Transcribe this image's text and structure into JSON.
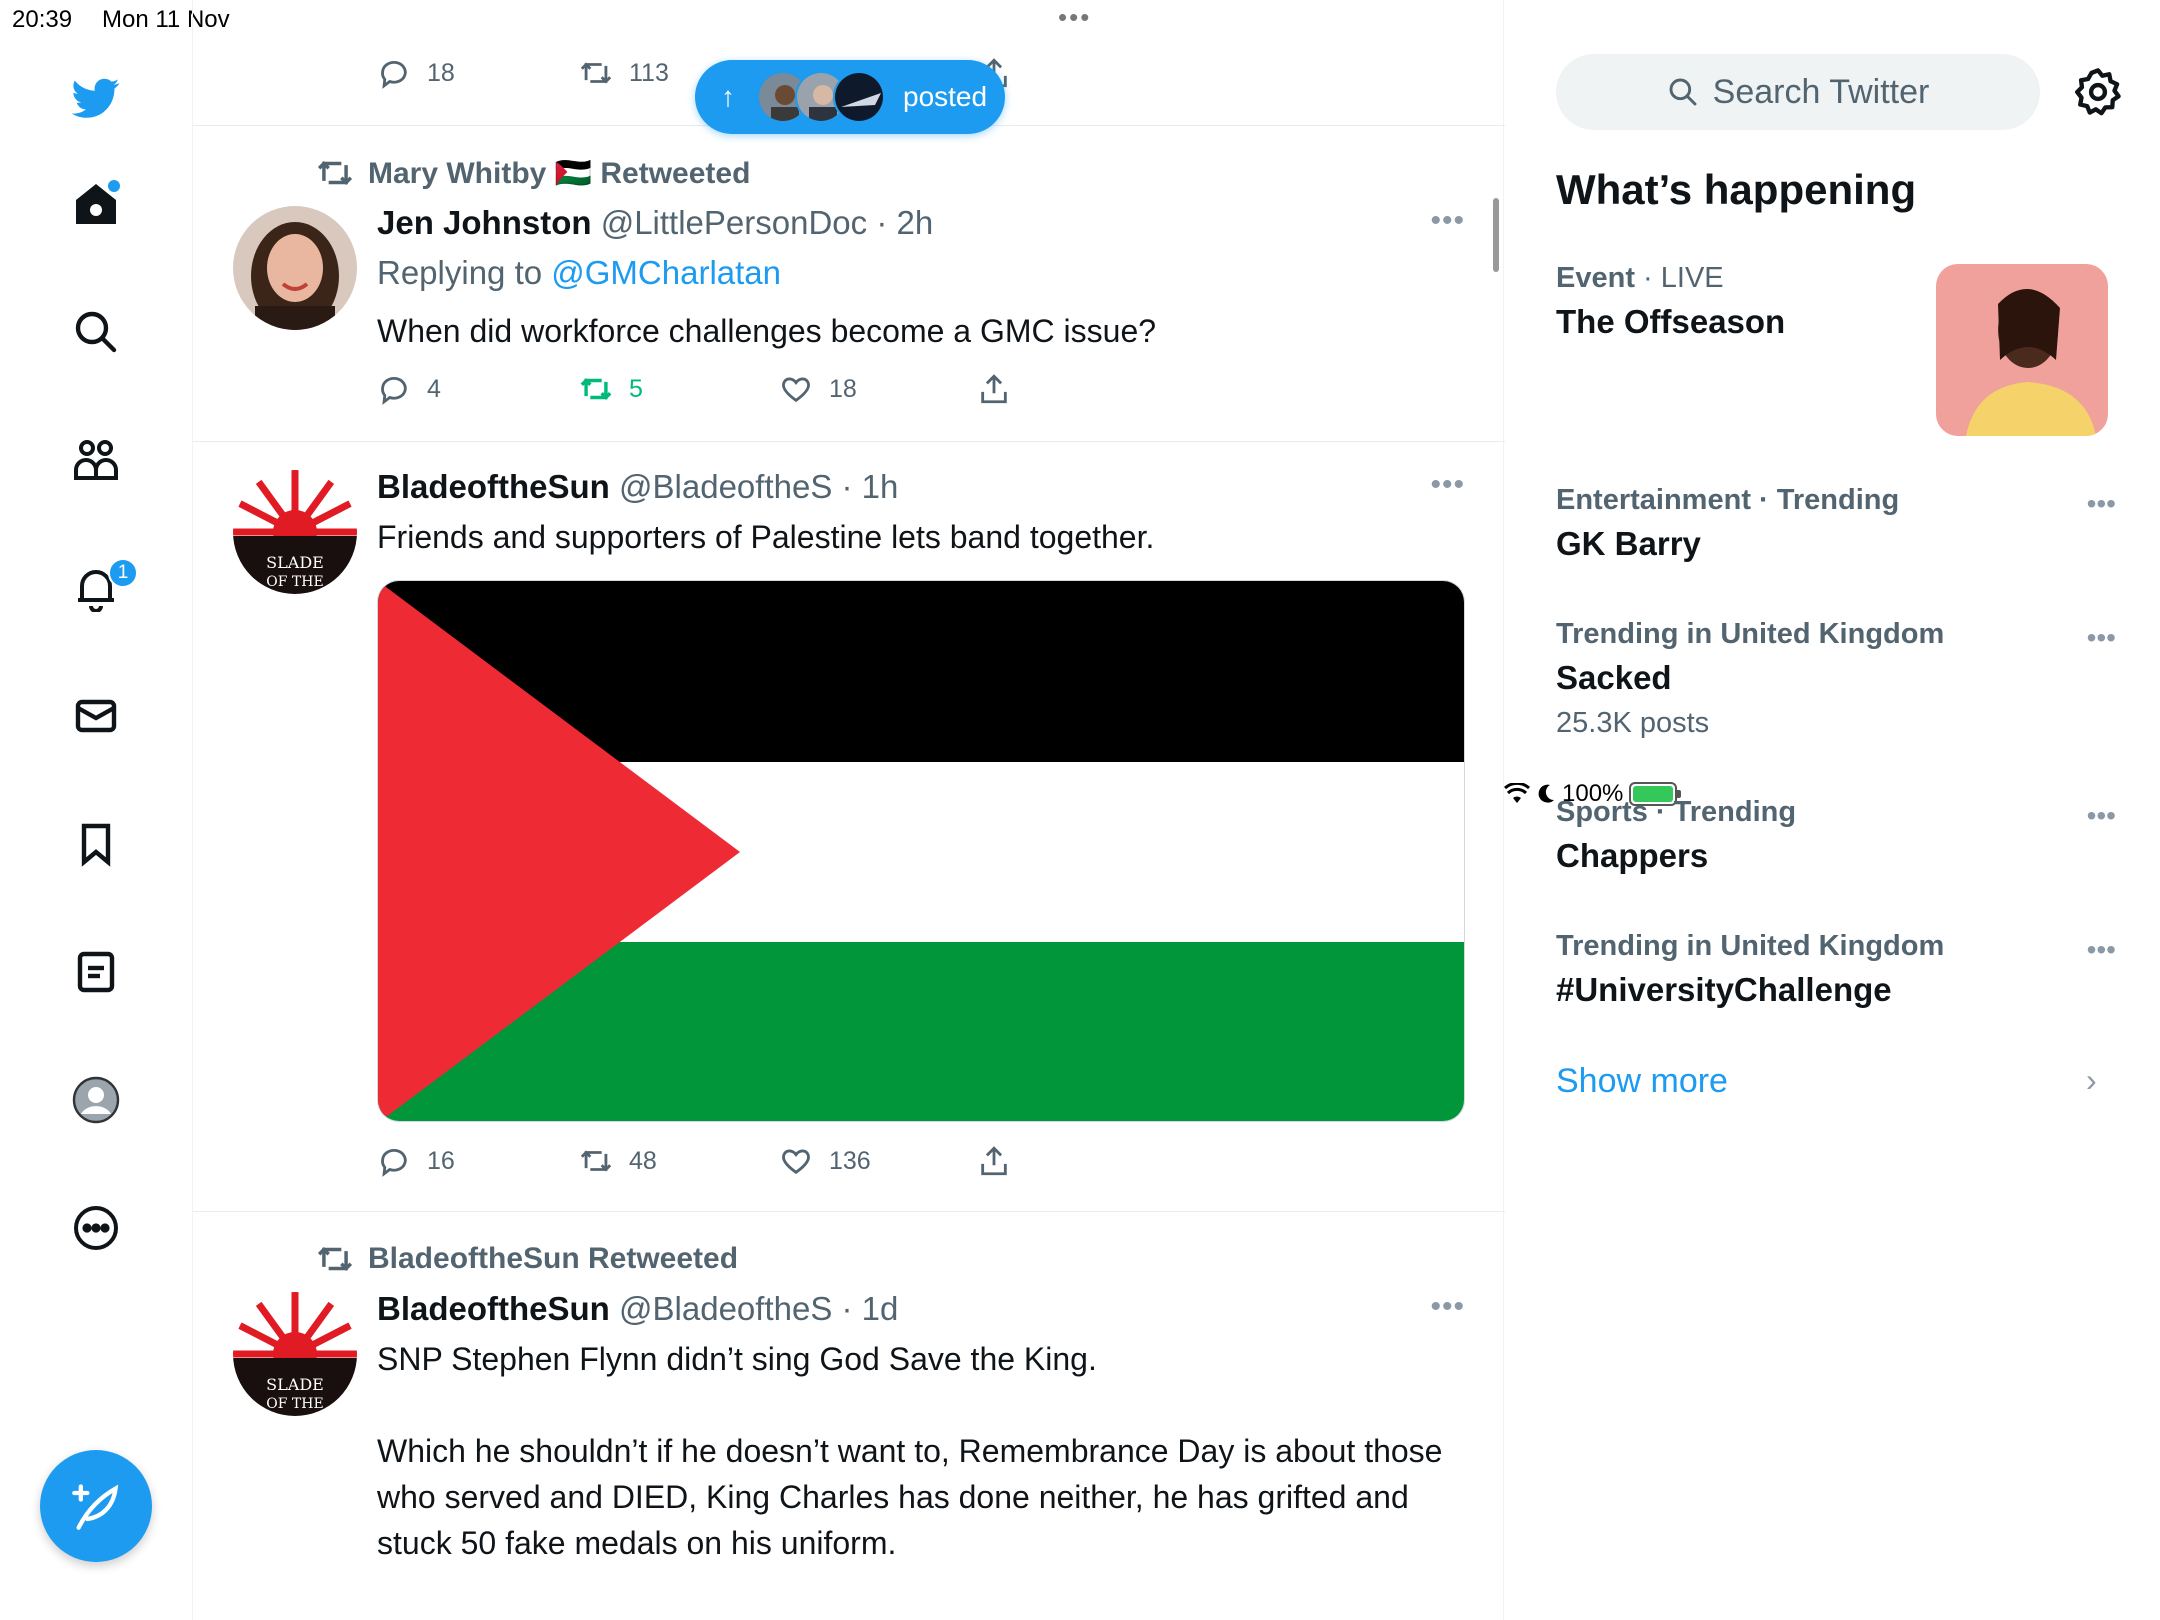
{
  "status_bar": {
    "time": "20:39",
    "date": "Mon 11 Nov",
    "battery": "100%"
  },
  "nav": {
    "notifications_badge": "1"
  },
  "top_tweet_actions": {
    "replies": "18",
    "retweets": "113"
  },
  "new_posts_pill": {
    "label": "posted"
  },
  "tweets": [
    {
      "context": "Mary Whitby 🇵🇸 Retweeted",
      "name": "Jen Johnston",
      "handle": "@LittlePersonDoc",
      "time": "· 2h",
      "replying_prefix": "Replying to ",
      "replying_to": "@GMCharlatan",
      "text": "When did workforce challenges become a GMC issue?",
      "replies": "4",
      "retweets": "5",
      "likes": "18"
    },
    {
      "name": "BladeoftheSun",
      "handle": "@BladeoftheS",
      "time": "· 1h",
      "text": "Friends and supporters of Palestine lets band together.",
      "replies": "16",
      "retweets": "48",
      "likes": "136"
    },
    {
      "context": "BladeoftheSun Retweeted",
      "name": "BladeoftheSun",
      "handle": "@BladeoftheS",
      "time": "· 1d",
      "text_line1": "SNP Stephen Flynn didn’t sing God Save the King.",
      "text_para2": "Which he shouldn’t if he doesn’t want to, Remembrance Day is about those who served and DIED, King Charles has done neither, he has grifted and stuck 50 fake medals on his uniform."
    }
  ],
  "sidebar": {
    "search_placeholder": "Search Twitter",
    "whats_happening": "What’s happening",
    "trends": [
      {
        "category": "Event",
        "qualifier": " · LIVE",
        "title": "The Offseason"
      },
      {
        "category": "Entertainment · Trending",
        "title": "GK Barry"
      },
      {
        "category": "Trending in United Kingdom",
        "title": "Sacked",
        "count": "25.3K posts"
      },
      {
        "category": "Sports · Trending",
        "title": "Chappers"
      },
      {
        "category": "Trending in United Kingdom",
        "title": "#UniversityChallenge"
      }
    ],
    "show_more": "Show more"
  },
  "colors": {
    "accent": "#1d9bf0",
    "retweet_green": "#00ba7c",
    "secondary_text": "#536471",
    "flag_red": "#ee2a35",
    "flag_green": "#009639"
  }
}
